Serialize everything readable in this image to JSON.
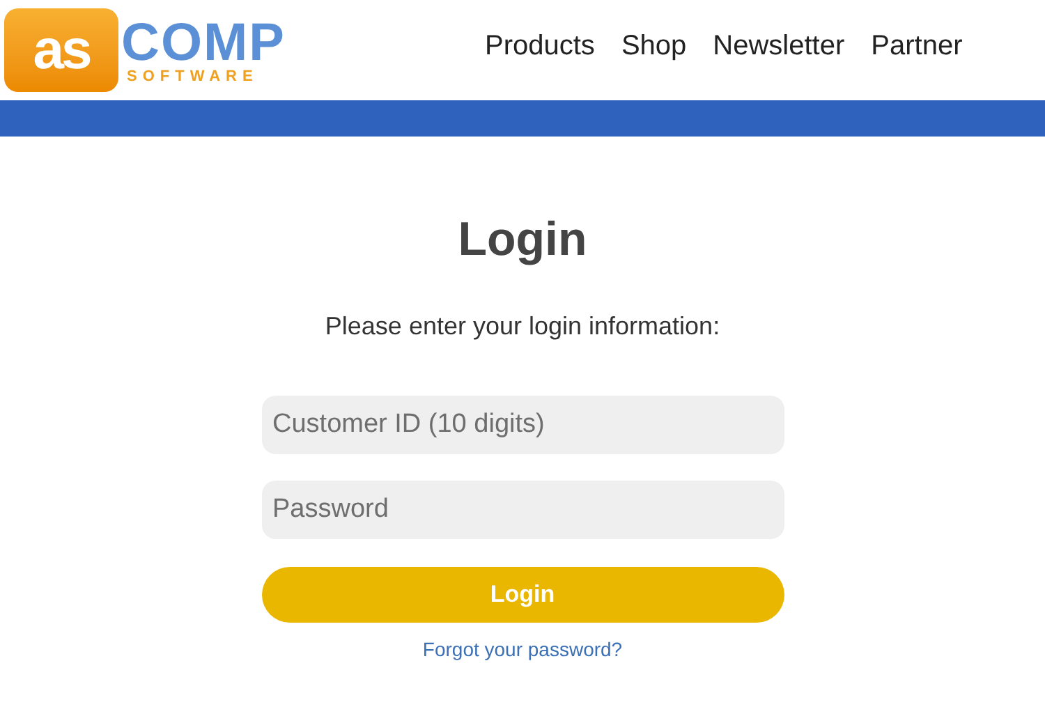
{
  "logo": {
    "mark": "as",
    "name": "COMP",
    "tagline": "SOFTWARE"
  },
  "nav": [
    "Products",
    "Shop",
    "Newsletter",
    "Partner"
  ],
  "login": {
    "title": "Login",
    "prompt": "Please enter your login information:",
    "fields": [
      {
        "placeholder": "Customer ID (10 digits)"
      },
      {
        "placeholder": "Password"
      }
    ],
    "button": "Login",
    "forgot_link": "Forgot your password?"
  }
}
